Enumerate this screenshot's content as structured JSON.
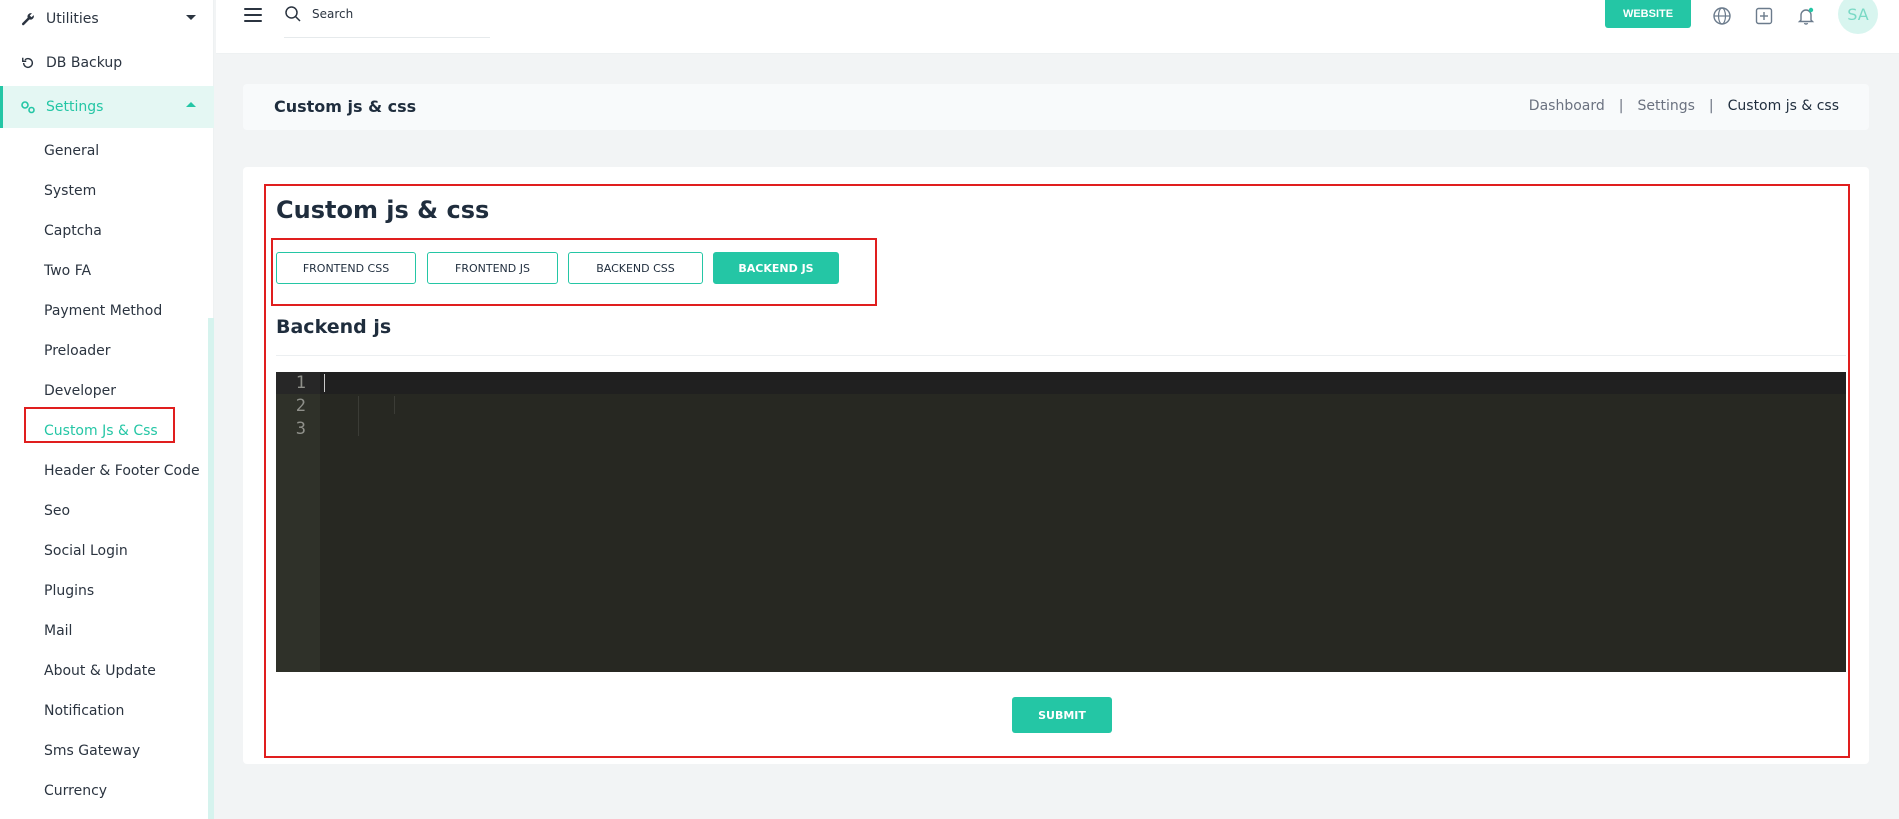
{
  "sidebar": {
    "items": [
      {
        "label": "Utilities",
        "icon": "wrench-icon"
      },
      {
        "label": "DB Backup",
        "icon": "history-icon"
      },
      {
        "label": "Settings",
        "icon": "cogs-icon"
      }
    ],
    "sub_items": [
      {
        "label": "General"
      },
      {
        "label": "System"
      },
      {
        "label": "Captcha"
      },
      {
        "label": "Two FA"
      },
      {
        "label": "Payment Method"
      },
      {
        "label": "Preloader"
      },
      {
        "label": "Developer"
      },
      {
        "label": "Custom Js & Css"
      },
      {
        "label": "Header & Footer Code"
      },
      {
        "label": "Seo"
      },
      {
        "label": "Social Login"
      },
      {
        "label": "Plugins"
      },
      {
        "label": "Mail"
      },
      {
        "label": "About & Update"
      },
      {
        "label": "Notification"
      },
      {
        "label": "Sms Gateway"
      },
      {
        "label": "Currency"
      }
    ]
  },
  "topbar": {
    "search_placeholder": "Search",
    "website_label": "WEBSITE",
    "avatar_initials": "SA"
  },
  "page_header": {
    "title": "Custom js & css",
    "breadcrumb": [
      "Dashboard",
      "Settings",
      "Custom js & css"
    ]
  },
  "card": {
    "title": "Custom js & css",
    "tabs": [
      {
        "label": "FRONTEND CSS"
      },
      {
        "label": "FRONTEND JS"
      },
      {
        "label": "BACKEND CSS"
      },
      {
        "label": "BACKEND JS"
      }
    ],
    "section_title": "Backend js",
    "editor_lines": [
      "1",
      "2",
      "3"
    ],
    "submit_label": "SUBMIT"
  },
  "colors": {
    "accent": "#24c6a5",
    "highlight_box": "#e01e1e",
    "editor_bg": "#272822"
  }
}
